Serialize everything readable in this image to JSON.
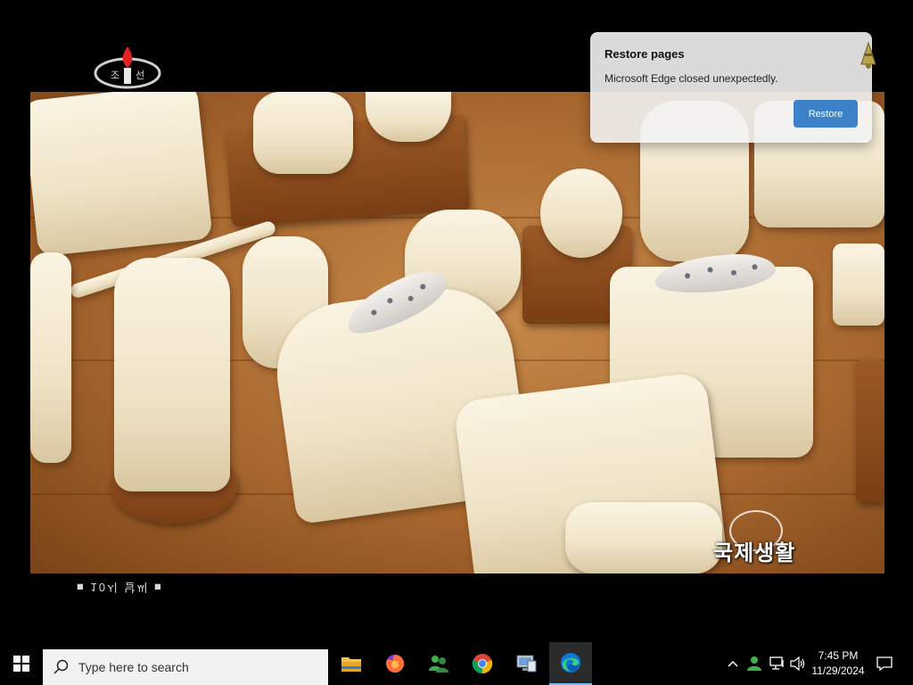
{
  "popup": {
    "title": "Restore pages",
    "message": "Microsoft Edge closed unexpectedly.",
    "button_label": "Restore"
  },
  "video": {
    "caption": "국제생활",
    "time_banner": "■ 10시 날씨 ■"
  },
  "taskbar": {
    "search_placeholder": "Type here to search",
    "apps": [
      "file-explorer",
      "firefox",
      "people",
      "chrome",
      "network-computer",
      "edge"
    ],
    "active_app": "edge",
    "clock_time": "7:45 PM",
    "clock_date": "11/29/2024"
  },
  "colors": {
    "taskbar_bg": "#000000",
    "accent": "#3b82c8",
    "popup_bg": "#f2f2f2"
  }
}
